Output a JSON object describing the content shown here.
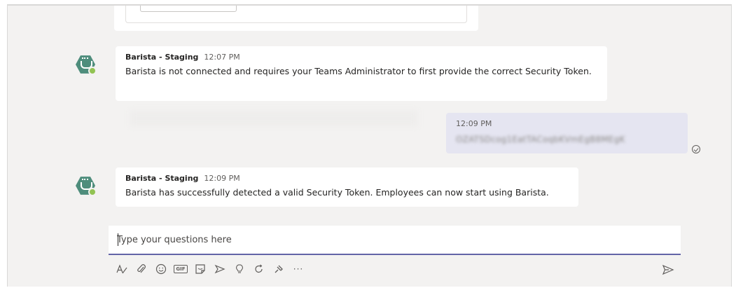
{
  "conversation": {
    "messages": [
      {
        "sender": "Barista - Staging",
        "time": "12:07 PM",
        "text": "Barista is not connected and requires your Teams Administrator to first provide the correct Security Token."
      },
      {
        "sender": "Barista - Staging",
        "time": "12:09 PM",
        "text": "Barista has successfully detected a valid Security Token. Employees can now start using Barista."
      }
    ],
    "my_reply": {
      "time": "12:09 PM",
      "text": "OZATSDcog1EatTACoqbKVmEgB8MEgK"
    }
  },
  "composer": {
    "placeholder": "Type your questions here"
  },
  "toolbar": {
    "icons": [
      "format-icon",
      "attach-icon",
      "emoji-icon",
      "gif-icon",
      "sticker-icon",
      "meet-icon",
      "praise-icon",
      "loop-icon",
      "stream-icon",
      "more-options-icon",
      "send-icon"
    ],
    "gif_label": "GIF",
    "more_label": "···"
  },
  "colors": {
    "accent": "#6264a7",
    "canvas": "#f3f2f1",
    "reply_bubble": "#e5e5f1",
    "bot_avatar": "#4e8d7c",
    "online_status": "#92c353"
  }
}
